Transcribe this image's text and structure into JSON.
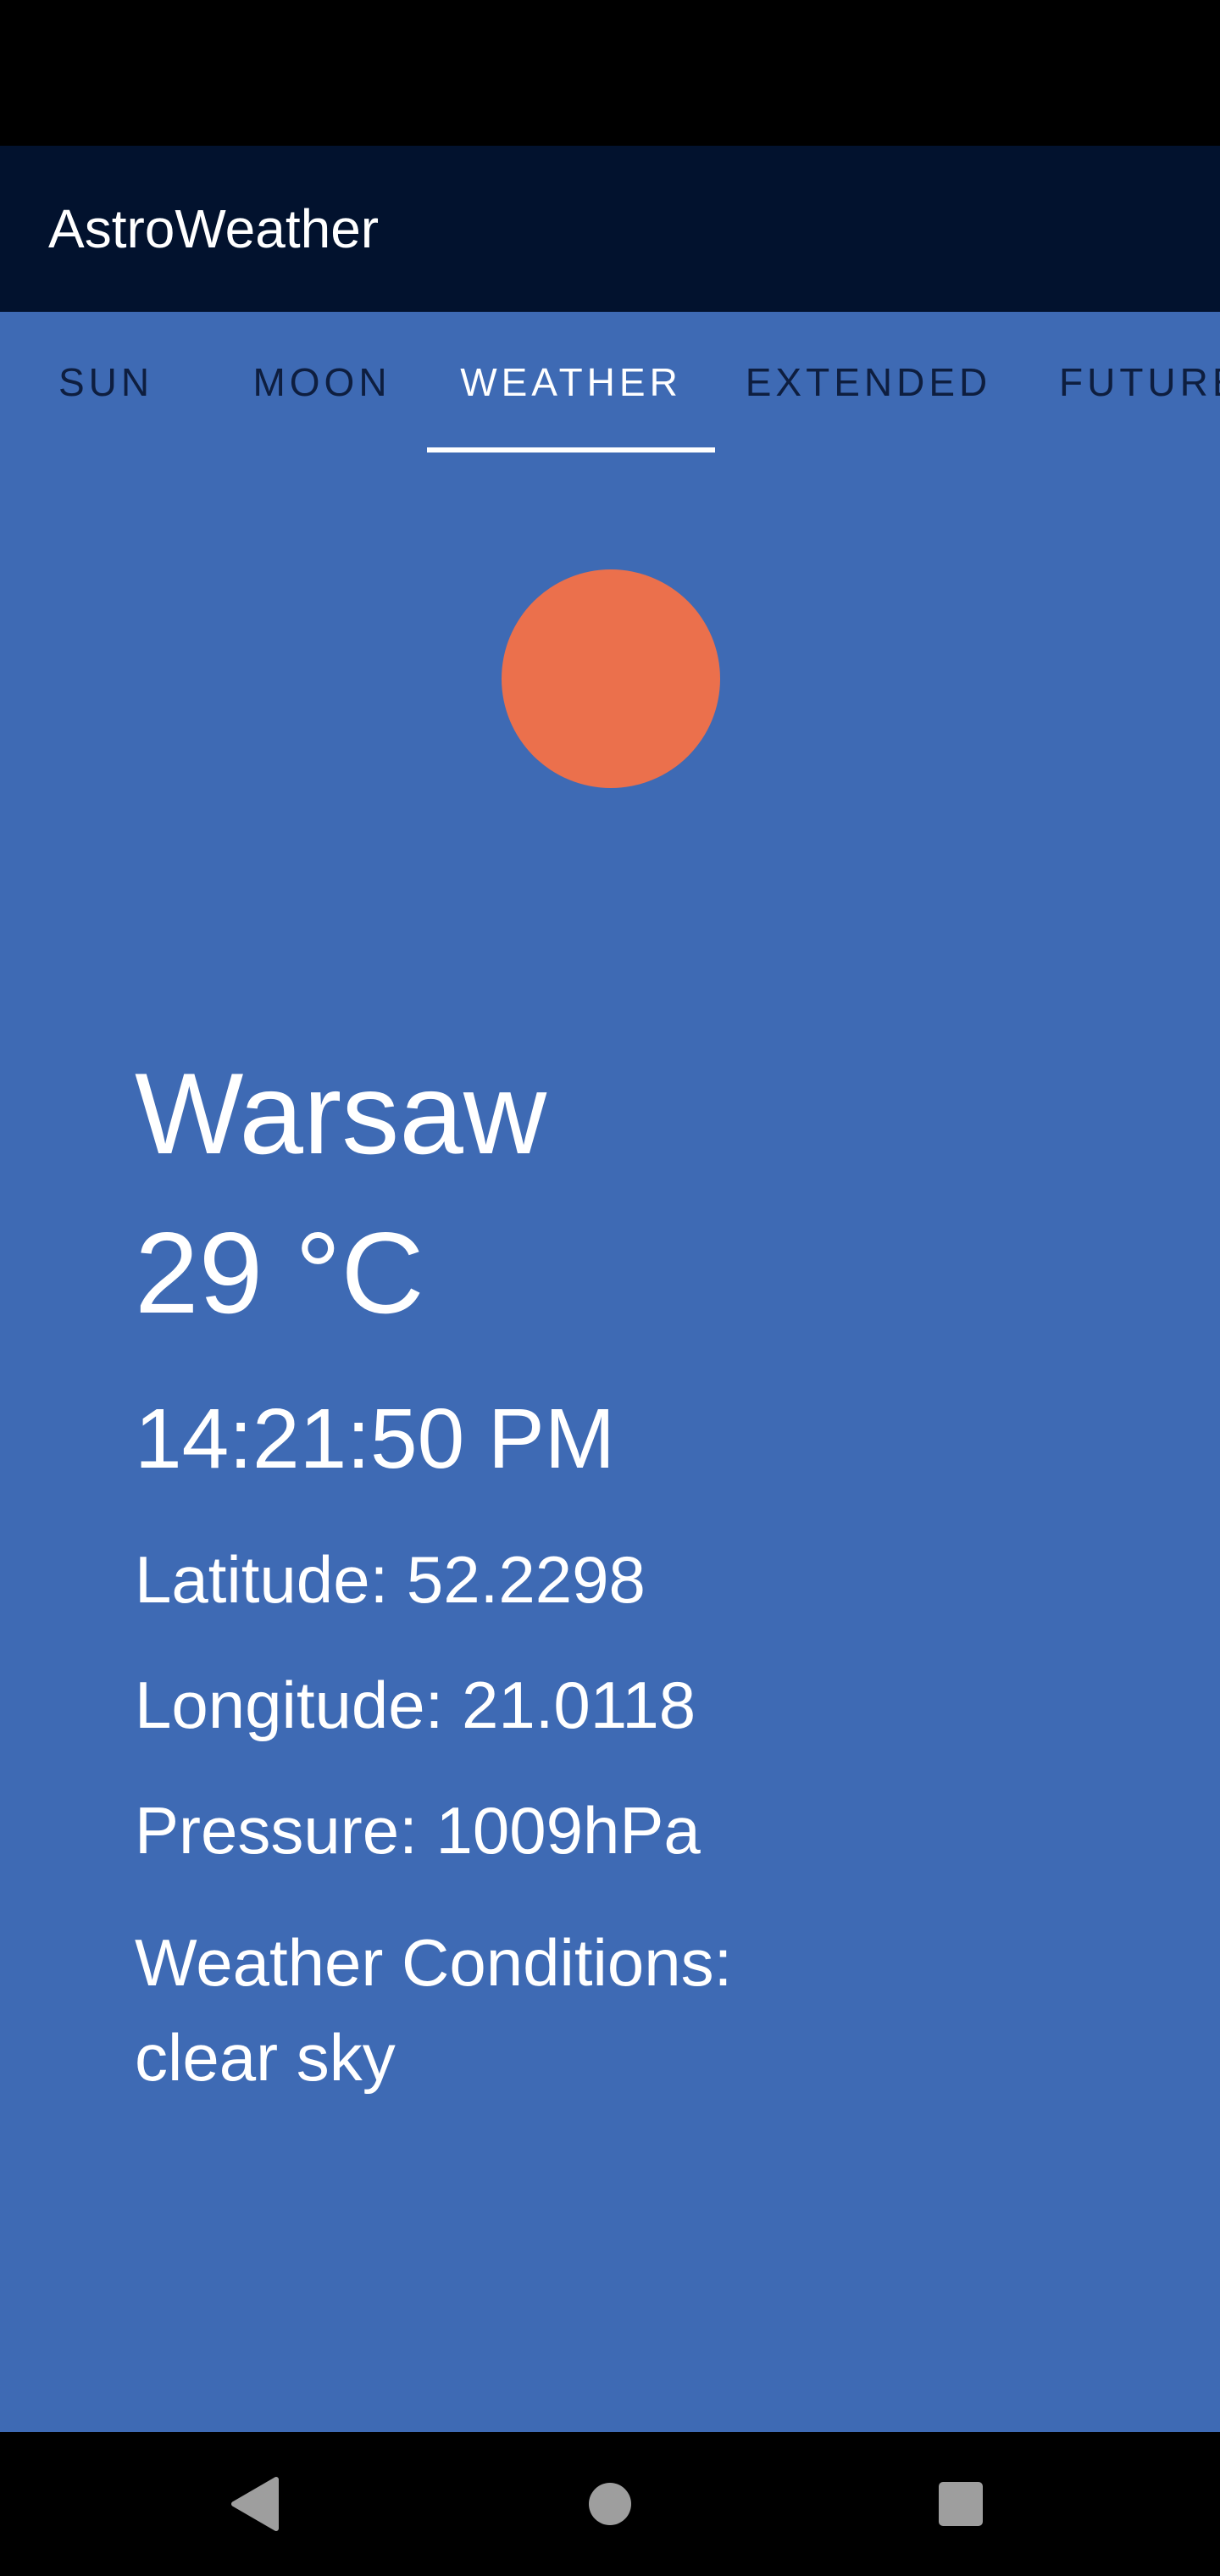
{
  "app_bar": {
    "title": "AstroWeather"
  },
  "tabs": [
    {
      "label": "SUN",
      "active": false
    },
    {
      "label": "MOON",
      "active": false
    },
    {
      "label": "WEATHER",
      "active": true
    },
    {
      "label": "EXTENDED",
      "active": false
    },
    {
      "label": "FUTURE",
      "active": false
    }
  ],
  "weather": {
    "icon": "sun-icon",
    "city": "Warsaw",
    "temperature": "29 °C",
    "time": "14:21:50 PM",
    "latitude": "Latitude: 52.2298",
    "longitude": "Longitude: 21.0118",
    "pressure": "Pressure: 1009hPa",
    "conditions_label": "Weather Conditions:",
    "conditions_value": "clear sky"
  },
  "nav": {
    "back_icon": "back-triangle-icon",
    "home_icon": "home-circle-icon",
    "recents_icon": "recents-square-icon"
  },
  "colors": {
    "app_bar": "#02122e",
    "background": "#3e6ab4",
    "sun": "#eb704c",
    "tab_inactive": "#0e1e3f",
    "tab_active": "#ffffff"
  }
}
